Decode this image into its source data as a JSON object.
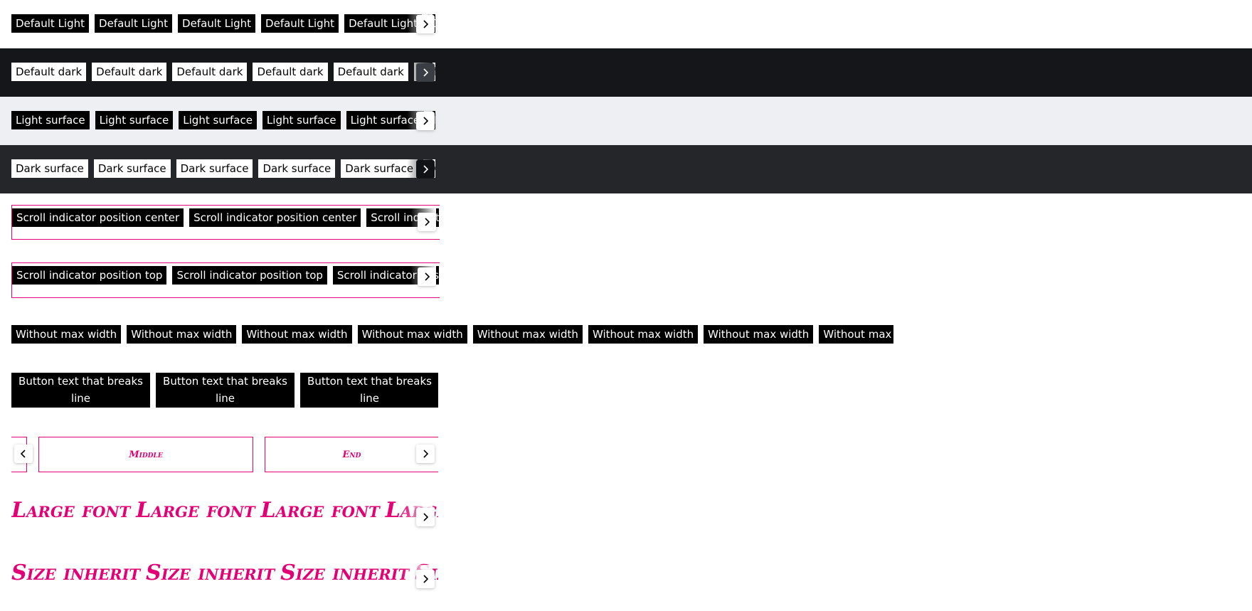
{
  "rows": {
    "default_light": {
      "label": "Default Light",
      "count": 6
    },
    "default_dark": {
      "label": "Default dark",
      "count": 6
    },
    "light_surface": {
      "label": "Light surface",
      "count": 6
    },
    "dark_surface": {
      "label": "Dark surface",
      "count": 6
    },
    "center": {
      "label": "Scroll indicator position center",
      "count": 3
    },
    "top": {
      "label": "Scroll indicator position top",
      "count": 3
    },
    "no_max": {
      "label": "Without max width",
      "count": 8
    },
    "wrap": {
      "label": "Button text that breaks line",
      "count": 3
    },
    "tabs": {
      "middle": "Middle",
      "end": "End"
    },
    "large": {
      "label": "Large font",
      "count": 4
    },
    "inherit": {
      "label": "Size inherit",
      "count": 4
    }
  },
  "colors": {
    "accent": "#e20074",
    "dark_band": "#151619",
    "dark_surface_band": "#25262a",
    "light_surface_band": "#edeff3"
  },
  "icons": {
    "next": "chevron-right-icon",
    "prev": "chevron-left-icon"
  }
}
